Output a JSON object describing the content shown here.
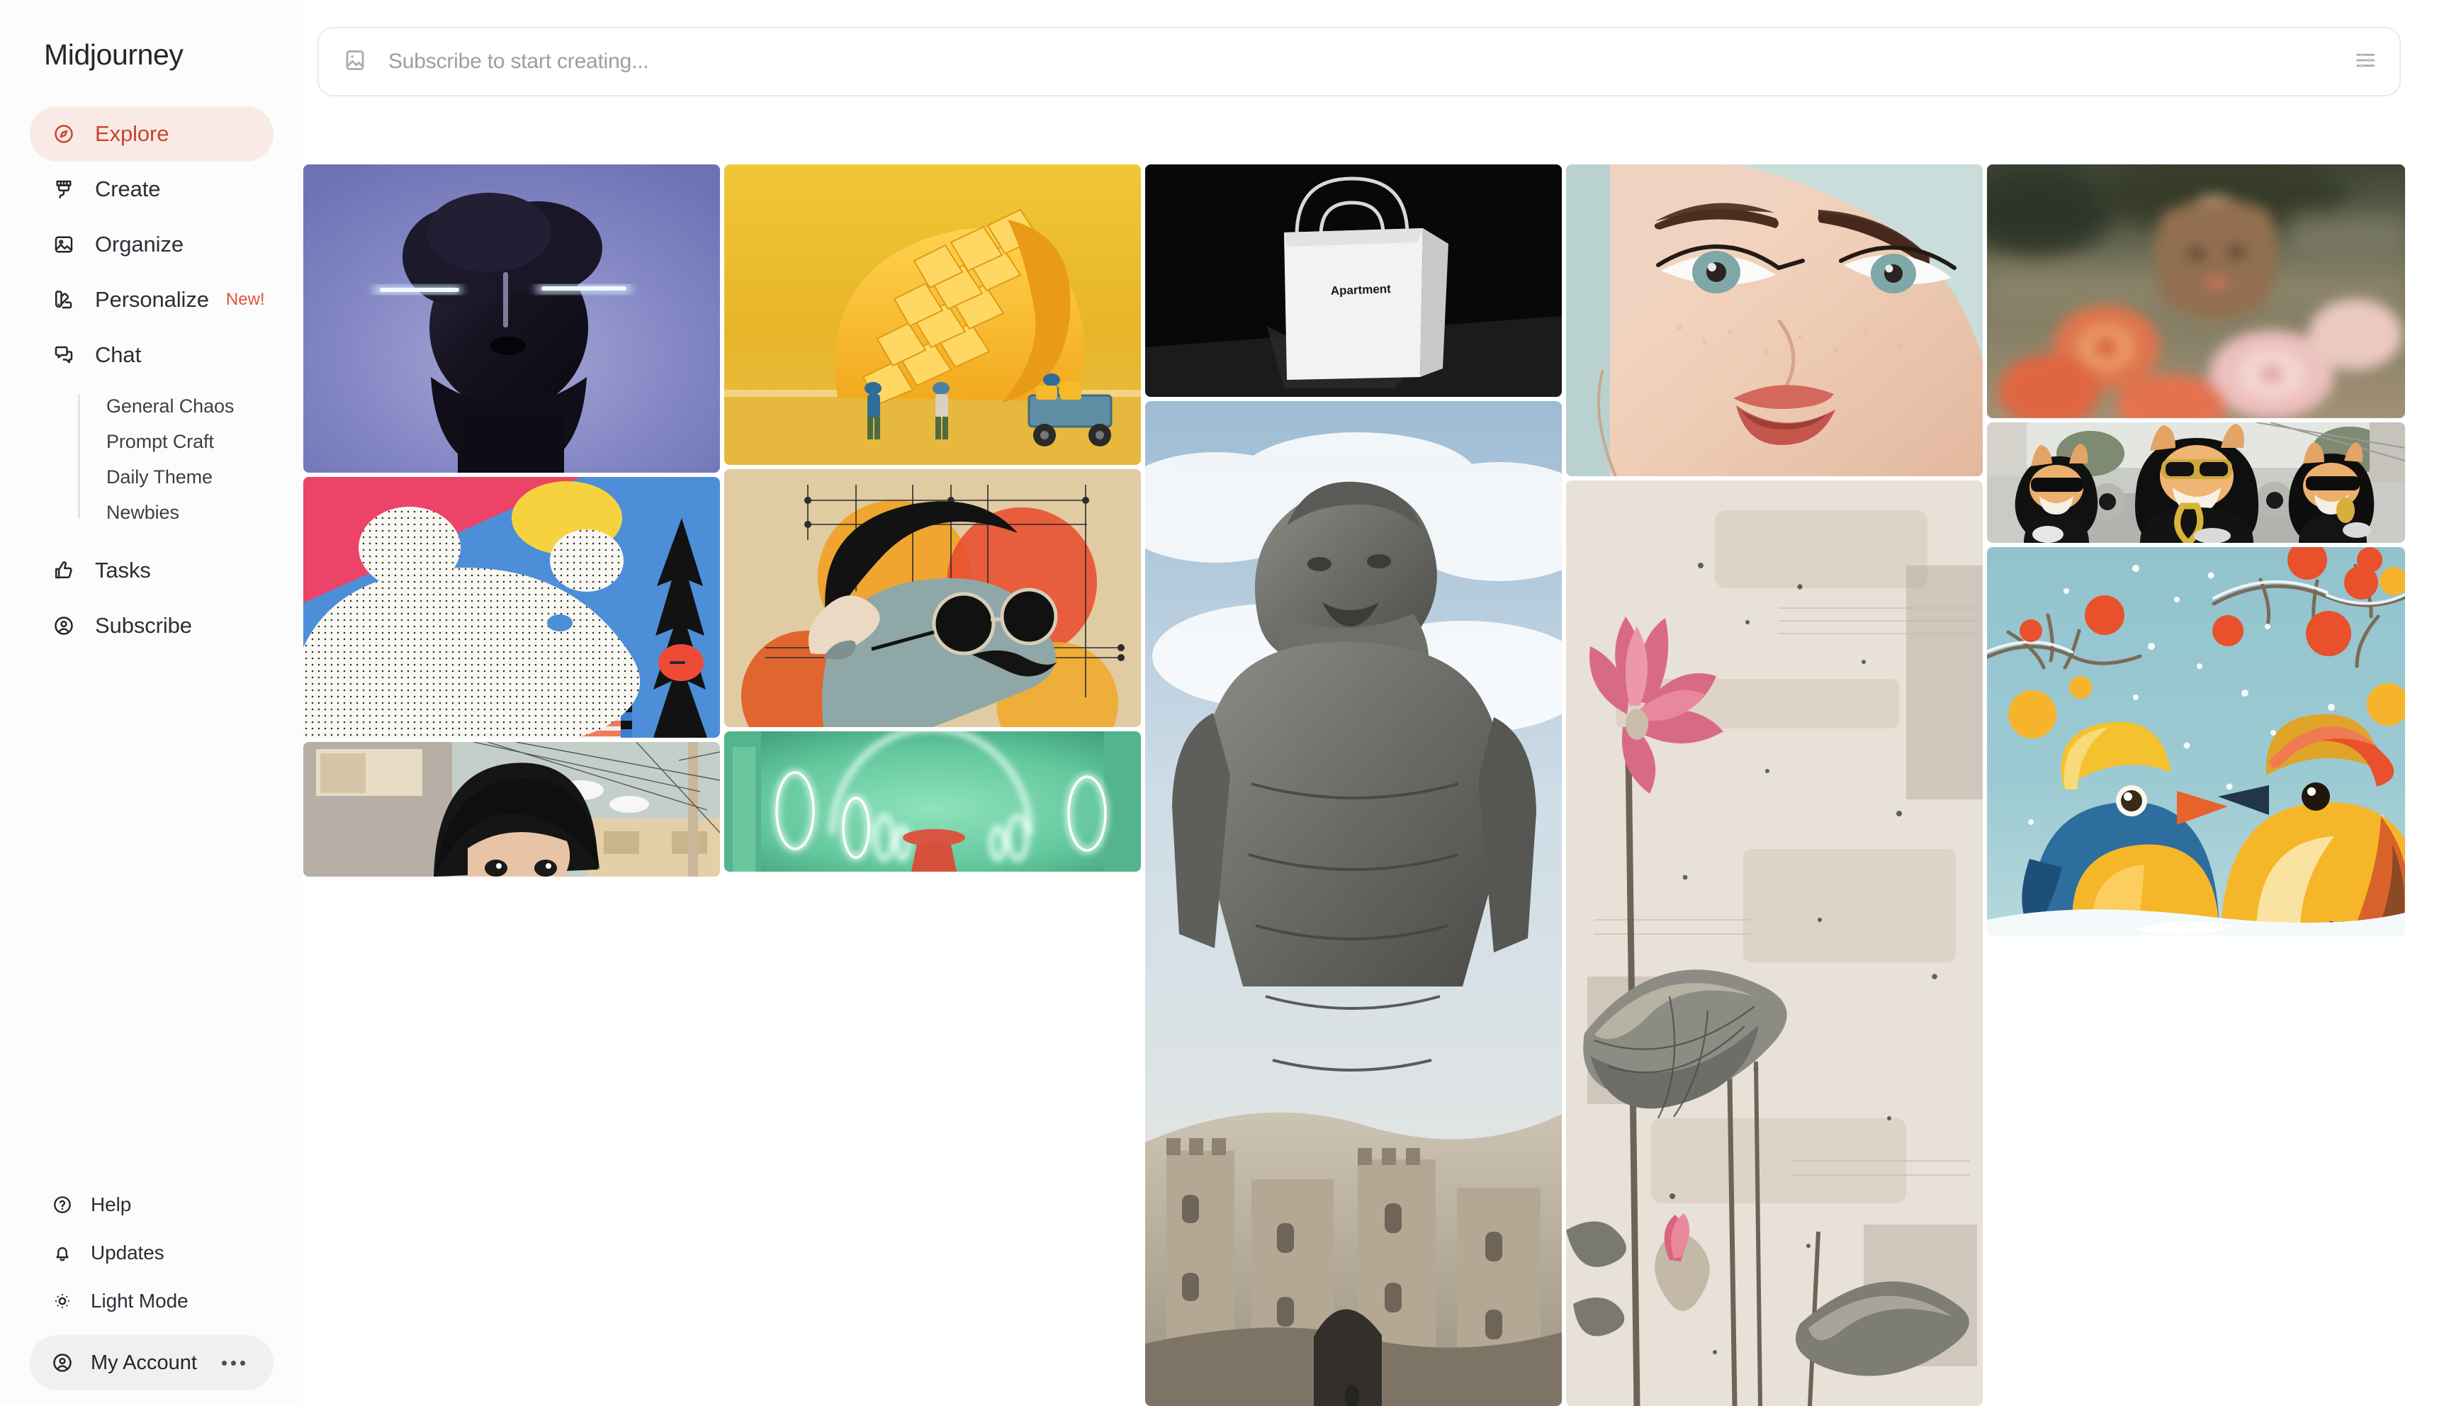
{
  "app": {
    "brand": "Midjourney"
  },
  "sidebar": {
    "nav": [
      {
        "label": "Explore",
        "icon": "compass-icon",
        "active": true,
        "badge": ""
      },
      {
        "label": "Create",
        "icon": "paintbrush-icon",
        "active": false,
        "badge": ""
      },
      {
        "label": "Organize",
        "icon": "image-icon",
        "active": false,
        "badge": ""
      },
      {
        "label": "Personalize",
        "icon": "swatches-icon",
        "active": false,
        "badge": "New!"
      },
      {
        "label": "Chat",
        "icon": "chat-bubble-icon",
        "active": false,
        "badge": ""
      }
    ],
    "chat_channels": [
      {
        "label": "General Chaos"
      },
      {
        "label": "Prompt Craft"
      },
      {
        "label": "Daily Theme"
      },
      {
        "label": "Newbies"
      }
    ],
    "nav2": [
      {
        "label": "Tasks",
        "icon": "thumbs-up-icon"
      },
      {
        "label": "Subscribe",
        "icon": "user-circle-icon"
      }
    ],
    "bottom": [
      {
        "label": "Help",
        "icon": "question-circle-icon"
      },
      {
        "label": "Updates",
        "icon": "bell-icon"
      },
      {
        "label": "Light Mode",
        "icon": "sun-icon"
      }
    ],
    "account": {
      "label": "My Account",
      "icon": "user-circle-icon",
      "menu_icon": "more-dots-icon"
    }
  },
  "prompt": {
    "placeholder": "Subscribe to start creating...",
    "value": "",
    "leading_icon": "image-icon",
    "trailing_icon": "sliders-icon"
  },
  "gallery": {
    "columns": [
      {
        "tiles": [
          {
            "name": "dark-sculptural-head-portrait",
            "alt_text": ""
          },
          {
            "name": "polar-bear-stipple-illustration",
            "alt_text": ""
          },
          {
            "name": "anime-boy-street-illustration",
            "alt_text": ""
          }
        ]
      },
      {
        "tiles": [
          {
            "name": "mango-miniature-workers-photo",
            "alt_text": ""
          },
          {
            "name": "vintage-collage-man-sunglasses",
            "alt_text": ""
          },
          {
            "name": "neon-green-corridor-red-figure",
            "alt_text": ""
          }
        ]
      },
      {
        "tiles": [
          {
            "name": "white-paper-shopping-bag",
            "alt_text": "Apartment"
          },
          {
            "name": "stone-giant-over-castle",
            "alt_text": ""
          }
        ]
      },
      {
        "tiles": [
          {
            "name": "closeup-female-face-portrait",
            "alt_text": ""
          },
          {
            "name": "lotus-ink-wash-painting",
            "alt_text": ""
          }
        ]
      },
      {
        "tiles": [
          {
            "name": "blurred-woman-with-flowers",
            "alt_text": ""
          },
          {
            "name": "hip-hop-cats-sunglasses-photo",
            "alt_text": ""
          },
          {
            "name": "two-winter-birds-in-hats",
            "alt_text": ""
          }
        ]
      }
    ],
    "bag_label": "Apartment"
  },
  "colors": {
    "accent": "#C8462A",
    "accent_soft": "#FAEAE6",
    "new_badge": "#E0543A",
    "text": "#23262B",
    "muted": "#9B9EA4",
    "sidebar_bg": "#FCFCFC",
    "account_bg": "#F0F0F1"
  }
}
